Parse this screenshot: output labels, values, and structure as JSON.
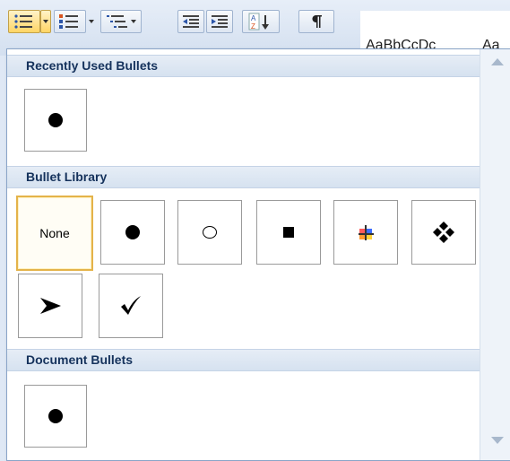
{
  "ribbon": {
    "toolbar_icons": [
      "bullets-icon",
      "numbering-icon",
      "multilevel-list-icon",
      "decrease-indent-icon",
      "increase-indent-icon",
      "sort-icon",
      "show-formatting-marks-icon"
    ],
    "styles": [
      "AaBbCcDc",
      "Aa"
    ]
  },
  "bullets_menu": {
    "sections": {
      "recent": {
        "title": "Recently Used Bullets"
      },
      "library": {
        "title": "Bullet Library"
      },
      "document": {
        "title": "Document Bullets"
      }
    },
    "recent_items": [
      "filled-circle-bullet"
    ],
    "library_items": [
      {
        "name": "none",
        "label": "None",
        "selected": true
      },
      {
        "name": "filled-circle-bullet"
      },
      {
        "name": "hollow-circle-bullet"
      },
      {
        "name": "filled-square-bullet"
      },
      {
        "name": "multicolor-cross-bullet"
      },
      {
        "name": "four-diamond-bullet"
      },
      {
        "name": "arrowhead-bullet"
      },
      {
        "name": "checkmark-bullet"
      }
    ],
    "document_items": [
      "filled-circle-bullet"
    ]
  },
  "colors": {
    "header_text": "#15325c",
    "selection_border": "#e4b34a",
    "panel_border": "#8aa5c8"
  }
}
